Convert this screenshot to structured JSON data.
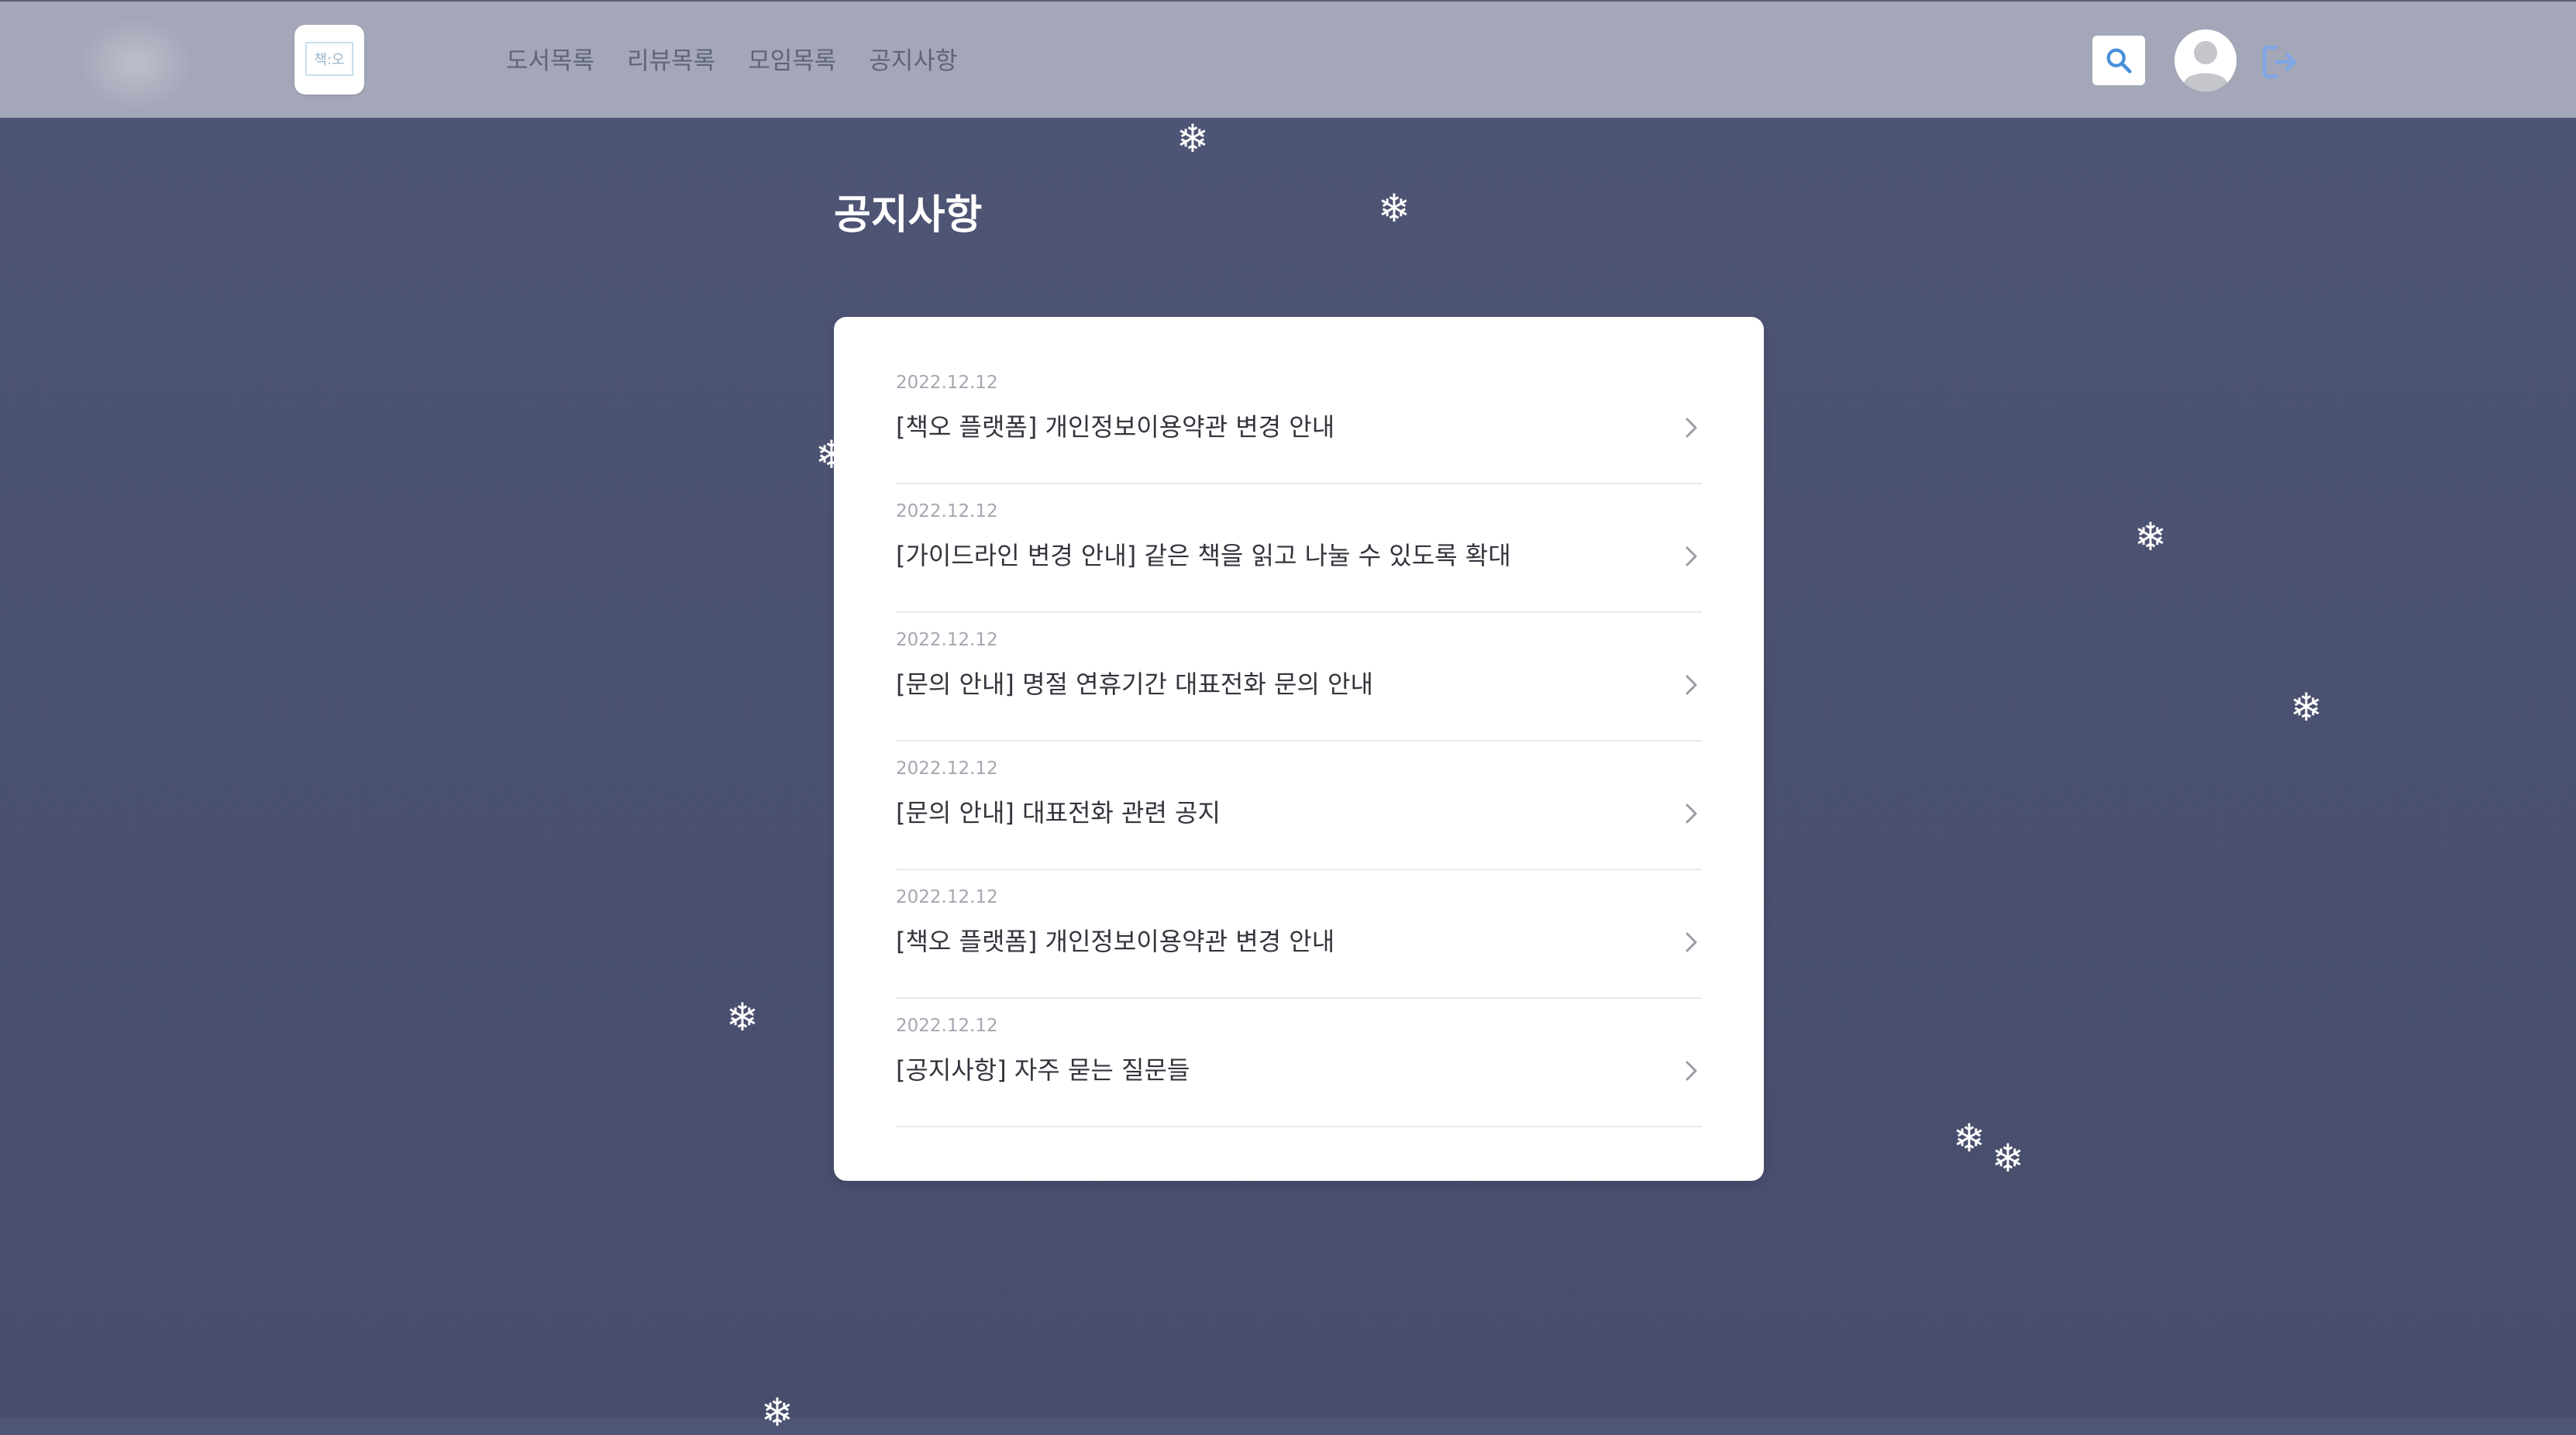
{
  "header": {
    "logo_text": "책:오",
    "nav": [
      {
        "label": "도서목록"
      },
      {
        "label": "리뷰목록"
      },
      {
        "label": "모임목록"
      },
      {
        "label": "공지사항"
      }
    ],
    "icons": {
      "search": "search-icon",
      "avatar": "user-avatar-icon",
      "logout": "logout-icon"
    }
  },
  "page": {
    "title": "공지사항"
  },
  "notices": [
    {
      "date": "2022.12.12",
      "title": "[책오 플랫폼] 개인정보이용약관 변경 안내"
    },
    {
      "date": "2022.12.12",
      "title": "[가이드라인 변경 안내] 같은 책을 읽고 나눌 수 있도록 확대"
    },
    {
      "date": "2022.12.12",
      "title": "[문의 안내] 명절 연휴기간 대표전화 문의 안내"
    },
    {
      "date": "2022.12.12",
      "title": "[문의 안내] 대표전화 관련 공지"
    },
    {
      "date": "2022.12.12",
      "title": "[책오 플랫폼] 개인정보이용약관 변경 안내"
    },
    {
      "date": "2022.12.12",
      "title": "[공지사항] 자주 묻는 질문들"
    }
  ],
  "decor": {
    "snowflake_glyph": "❄"
  },
  "colors": {
    "background": "#4b5170",
    "header": "#a3a7b8",
    "accent": "#4a90d9",
    "logout_icon": "#7fa6e6"
  }
}
